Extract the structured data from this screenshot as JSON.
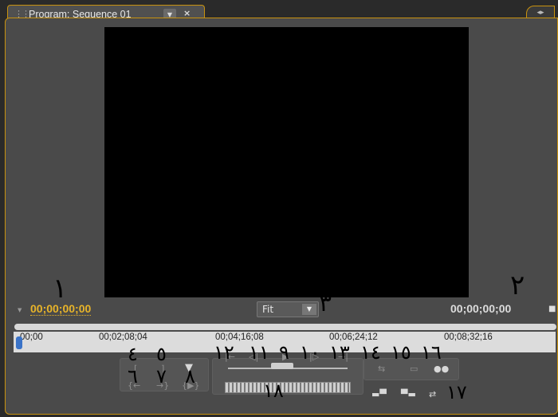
{
  "panel": {
    "tab_title": "Program: Sequence 01",
    "tab_menu_glyph": "▼",
    "close_glyph": "×",
    "panel_menu_glyph": "◂▸"
  },
  "timecode": {
    "current": "00;00;00;00",
    "duration": "00;00;00;00"
  },
  "zoom": {
    "value": "Fit"
  },
  "ruler": {
    "ticks": [
      "00;00",
      "00;02;08;04",
      "00;04;16;08",
      "00;06;24;12",
      "00;08;32;16"
    ]
  },
  "controls": {
    "mark_in": "mark-in-icon",
    "mark_out": "mark-out-icon",
    "set_marker": "marker-icon",
    "go_to_in": "go-to-in-icon",
    "go_to_out": "go-to-out-icon",
    "play_in_to_out": "play-in-to-out-icon",
    "go_prev_edit": "previous-edit-icon",
    "step_back": "step-back-icon",
    "play": "play-icon",
    "step_forward": "step-forward-icon",
    "go_next_edit": "next-edit-icon",
    "loop": "loop-icon",
    "safe_margins": "safe-margins-icon",
    "output": "output-icon",
    "lift": "lift-icon",
    "extract": "extract-icon",
    "trim": "trim-icon"
  },
  "annotations": {
    "n1": "١",
    "n2": "٢",
    "n3": "٣",
    "n4": "٤",
    "n5": "٥",
    "n6": "٦",
    "n7": "٧",
    "n8": "٨",
    "n9": "٩",
    "n10": "١٠",
    "n11": "١١",
    "n12": "١٢",
    "n13": "١٣",
    "n14": "١٤",
    "n15": "١٥",
    "n16": "١٦",
    "n17": "١٧",
    "n18": "١٨"
  }
}
